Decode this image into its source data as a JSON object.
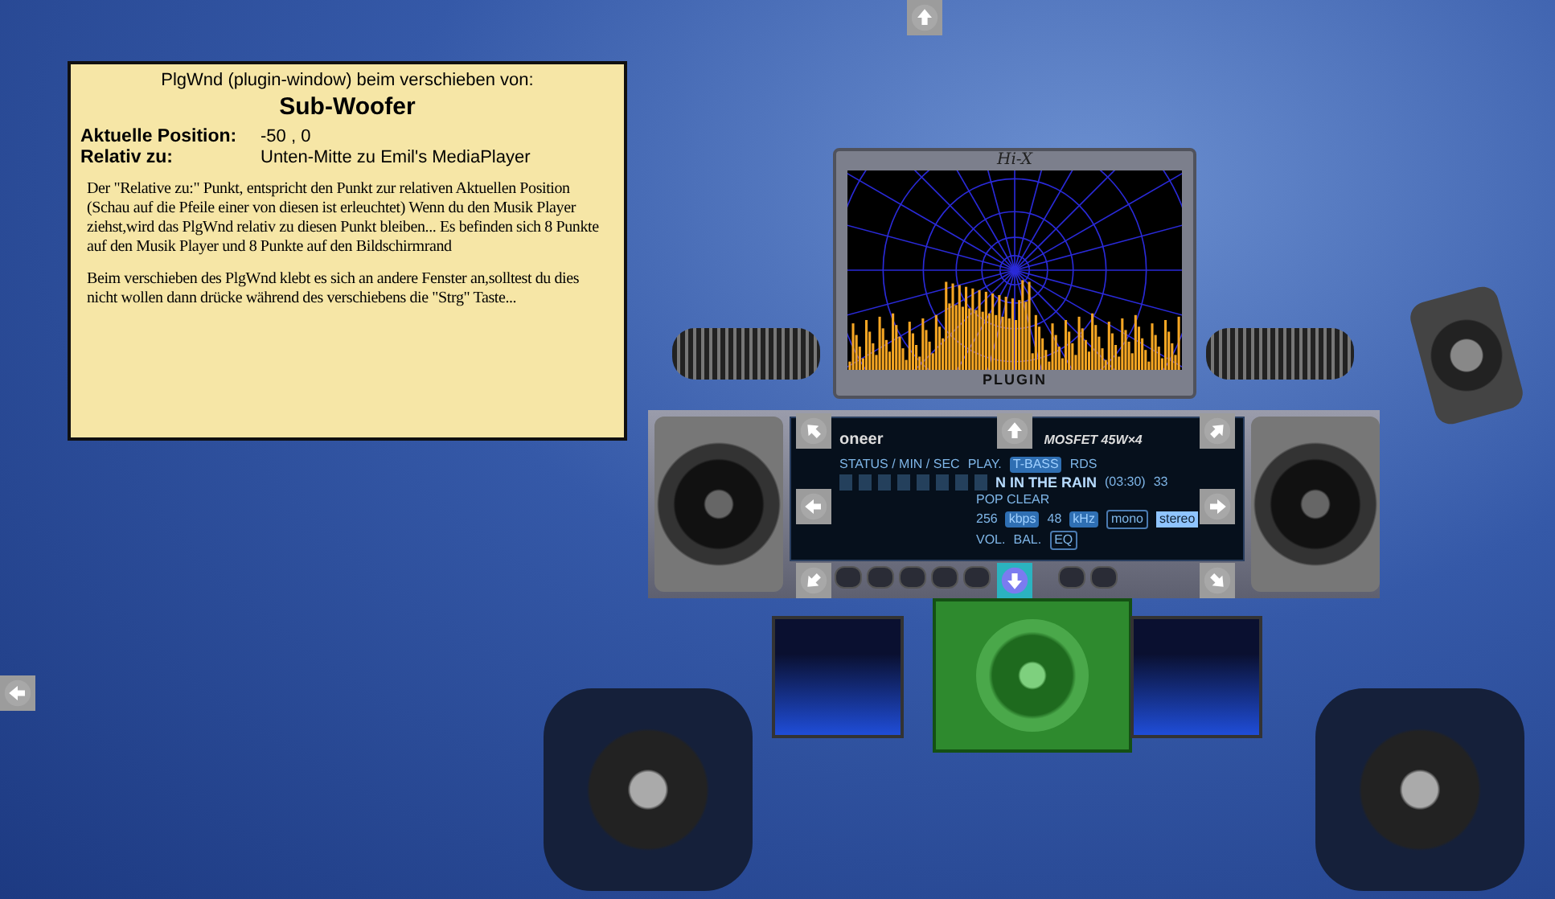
{
  "info_panel": {
    "heading": "PlgWnd (plugin-window) beim verschieben von:",
    "title": "Sub-Woofer",
    "fields": [
      {
        "label": "Aktuelle Position:",
        "value": "-50 , 0"
      },
      {
        "label": "Relativ zu:",
        "value": "Unten-Mitte zu Emil's MediaPlayer"
      }
    ],
    "paragraphs": [
      "Der \"Relative zu:\" Punkt, entspricht den Punkt zur relativen Aktuellen Position (Schau auf die Pfeile einer von diesen ist erleuchtet) Wenn du den Musik Player ziehst,wird das PlgWnd relativ zu diesen Punkt bleiben... Es befinden sich 8 Punkte auf den Musik Player und 8 Punkte auf den Bildschirmrand",
      "Beim verschieben des PlgWnd klebt es sich an andere Fenster an,solltest du dies nicht wollen dann drücke während des verschiebens die \"Strg\" Taste..."
    ]
  },
  "visualizer": {
    "title": "Hi-X",
    "footer": "PLUGIN"
  },
  "player": {
    "brand": "oneer",
    "model": "MOSFET 45W×4",
    "status_label": "STATUS / MIN / SEC",
    "mode": "PLAY.",
    "bass": "T-BASS",
    "rds": "RDS",
    "track": "N IN THE RAIN",
    "length": "(03:30)",
    "number": "33",
    "eq_preset": "POP CLEAR",
    "bitrate": "256",
    "bitrate_unit": "kbps",
    "rate": "48",
    "rate_unit": "kHz",
    "mono": "mono",
    "stereo": "stereo",
    "vol": "VOL.",
    "bal": "BAL.",
    "eq": "EQ"
  },
  "arrows": [
    {
      "kind": "up",
      "lit": false
    },
    {
      "kind": "left",
      "lit": false
    },
    {
      "kind": "up-left",
      "lit": false
    },
    {
      "kind": "up",
      "lit": false
    },
    {
      "kind": "up-right",
      "lit": false
    },
    {
      "kind": "left",
      "lit": false
    },
    {
      "kind": "right",
      "lit": false
    },
    {
      "kind": "down-left",
      "lit": false
    },
    {
      "kind": "down",
      "lit": true
    },
    {
      "kind": "down-right",
      "lit": false
    }
  ]
}
